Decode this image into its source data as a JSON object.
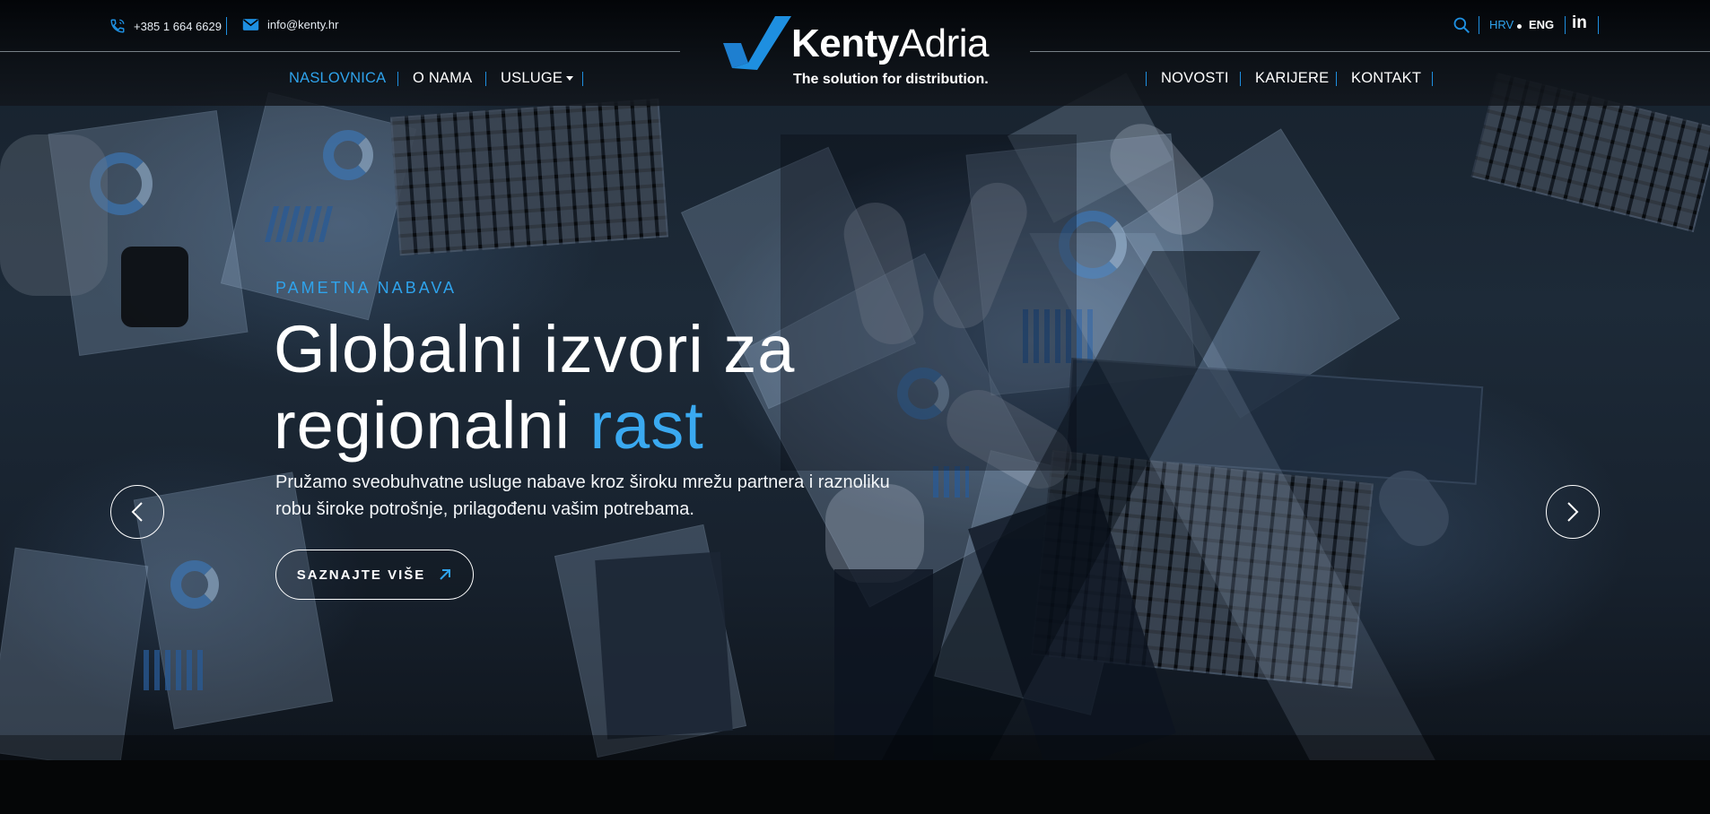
{
  "header": {
    "phone": {
      "icon": "phone-icon",
      "text": "+385 1 664 6629"
    },
    "email": {
      "icon": "mail-icon",
      "text": "info@kenty.hr"
    },
    "logo": {
      "name_bold": "Kenty",
      "name_thin": "Adria",
      "tagline": "The solution for distribution."
    },
    "languages": {
      "active": "HRV",
      "other": "ENG"
    },
    "search_icon": "search-icon",
    "social_icon": "linkedin-icon",
    "social_label": "in"
  },
  "nav": {
    "left": [
      {
        "label": "NASLOVNICA",
        "active": true
      },
      {
        "label": "O NAMA",
        "active": false
      },
      {
        "label": "USLUGE",
        "active": false,
        "dropdown": true
      }
    ],
    "right": [
      {
        "label": "NOVOSTI",
        "active": false
      },
      {
        "label": "KARIJERE",
        "active": false
      },
      {
        "label": "KONTAKT",
        "active": false
      }
    ]
  },
  "hero": {
    "eyebrow": "PAMETNA NABAVA",
    "headline_line1": "Globalni izvori za",
    "headline_line2_plain": "regionalni ",
    "headline_line2_accent": "rast",
    "lead": "Pružamo sveobuhvatne usluge nabave kroz širokumrežu partnera i raznoliku robu široke potrošnje, prilagođenu vašim potrebama.",
    "lead_line1": "Pružamo sveobuhvatne usluge nabave kroz široku mrežu partnera i raznoliku",
    "lead_line2": "robu široke potrošnje, prilagođenu vašim potrebama.",
    "cta_label": "SAZNAJTE VIŠE",
    "cta_icon": "arrow-up-right-icon",
    "prev_icon": "chevron-left-icon",
    "next_icon": "chevron-right-icon"
  },
  "colors": {
    "accent": "#2fa3ec",
    "background": "#050607",
    "text": "#ffffff"
  }
}
